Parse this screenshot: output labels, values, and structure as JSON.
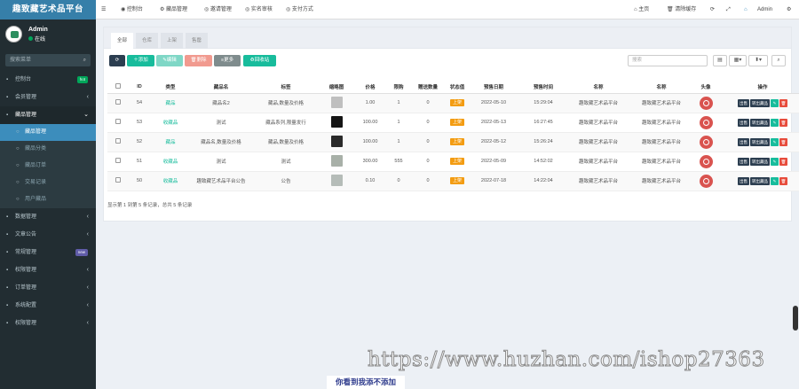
{
  "app": {
    "title": "趣致藏艺术品平台"
  },
  "user": {
    "name": "Admin",
    "status": "在线"
  },
  "sidebar": {
    "search_placeholder": "搜索菜单",
    "items": [
      {
        "label": "控制台",
        "icon": "dashboard-icon",
        "badge": "hot",
        "badge_color": "#00a65a"
      },
      {
        "label": "会员管理",
        "icon": "user-icon",
        "arrow": "‹"
      },
      {
        "label": "藏品管理",
        "icon": "gear-icon",
        "arrow": "⌄",
        "open": true,
        "children": [
          {
            "label": "藏品管理",
            "active": true
          },
          {
            "label": "藏品分类"
          },
          {
            "label": "藏品订单"
          },
          {
            "label": "交易记录"
          },
          {
            "label": "用户藏品"
          }
        ]
      },
      {
        "label": "数据管理",
        "icon": "table-icon",
        "arrow": "‹"
      },
      {
        "label": "文章公告",
        "icon": "doc-icon",
        "arrow": "‹"
      },
      {
        "label": "常规管理",
        "icon": "cog-icon",
        "badge": "new",
        "badge_color": "#605ca8"
      },
      {
        "label": "权限管理",
        "icon": "group-icon",
        "arrow": "‹"
      },
      {
        "label": "订单管理",
        "icon": "list-icon",
        "arrow": "‹"
      },
      {
        "label": "系统配置",
        "icon": "settings-icon",
        "arrow": "‹"
      },
      {
        "label": "权限管理",
        "icon": "group-icon",
        "arrow": "‹"
      }
    ]
  },
  "topbar": {
    "tabs": [
      {
        "label": "控制台",
        "icon": "dashboard-icon"
      },
      {
        "label": "藏品管理",
        "icon": "gear-icon"
      },
      {
        "label": "邀请管理",
        "icon": "circle-icon"
      },
      {
        "label": "实名审核",
        "icon": "circle-icon"
      },
      {
        "label": "支付方式",
        "icon": "circle-icon"
      }
    ],
    "home": "主页",
    "clear_cache": "清除缓存",
    "admin": "Admin"
  },
  "panel": {
    "tabs": [
      "全部",
      "仓库",
      "上架",
      "售罄"
    ],
    "toolbar": {
      "add": "添加",
      "edit": "编辑",
      "delete": "删除",
      "more": "更多",
      "recycle": "回收站",
      "search_placeholder": "搜索"
    },
    "columns": [
      "ID",
      "类型",
      "藏品名",
      "标签",
      "缩略图",
      "价格",
      "限购",
      "赠送数量",
      "状态值",
      "预售日期",
      "预售时间",
      "名称",
      "名称",
      "头像",
      "操作"
    ],
    "rows": [
      {
        "id": "54",
        "type": "藏品",
        "name": "藏品名2",
        "tag": "藏品,数量及价格",
        "price": "1.00",
        "limit": "1",
        "gift": "0",
        "status": "上架",
        "date": "2022-05-10",
        "time": "15:29:04",
        "n1": "趣致藏艺术品平台",
        "n2": "趣致藏艺术品平台",
        "thumb": "#bfbfbf"
      },
      {
        "id": "53",
        "type": "收藏品",
        "name": "测试",
        "tag": "藏品系列,限量发行",
        "price": "100.00",
        "limit": "1",
        "gift": "0",
        "status": "上架",
        "date": "2022-05-13",
        "time": "16:27:45",
        "n1": "趣致藏艺术品平台",
        "n2": "趣致藏艺术品平台",
        "thumb": "#151515"
      },
      {
        "id": "52",
        "type": "藏品",
        "name": "藏品名,数量及价格",
        "tag": "藏品,数量及价格",
        "price": "100.00",
        "limit": "1",
        "gift": "0",
        "status": "上架",
        "date": "2022-05-12",
        "time": "15:26:24",
        "n1": "趣致藏艺术品平台",
        "n2": "趣致藏艺术品平台",
        "thumb": "#2a2a2a"
      },
      {
        "id": "51",
        "type": "收藏品",
        "name": "测试",
        "tag": "测试",
        "price": "300.00",
        "limit": "555",
        "gift": "0",
        "status": "上架",
        "date": "2022-05-09",
        "time": "14:52:02",
        "n1": "趣致藏艺术品平台",
        "n2": "趣致藏艺术品平台",
        "thumb": "#a8b0a8"
      },
      {
        "id": "50",
        "type": "收藏品",
        "name": "趣致藏艺术品平台公告",
        "tag": "公告",
        "price": "0.10",
        "limit": "0",
        "gift": "0",
        "status": "上架",
        "date": "2022-07-18",
        "time": "14:22:04",
        "n1": "趣致藏艺术品平台",
        "n2": "趣致藏艺术品平台",
        "thumb": "#b5bcb8"
      }
    ],
    "row_actions": [
      "出售",
      "转出藏品"
    ],
    "footer": "显示第 1 到第 5 条记录，总共 5 条记录"
  },
  "watermark": "https://www.huzhan.com/ishop27363",
  "caption": "你看到我添不添加"
}
